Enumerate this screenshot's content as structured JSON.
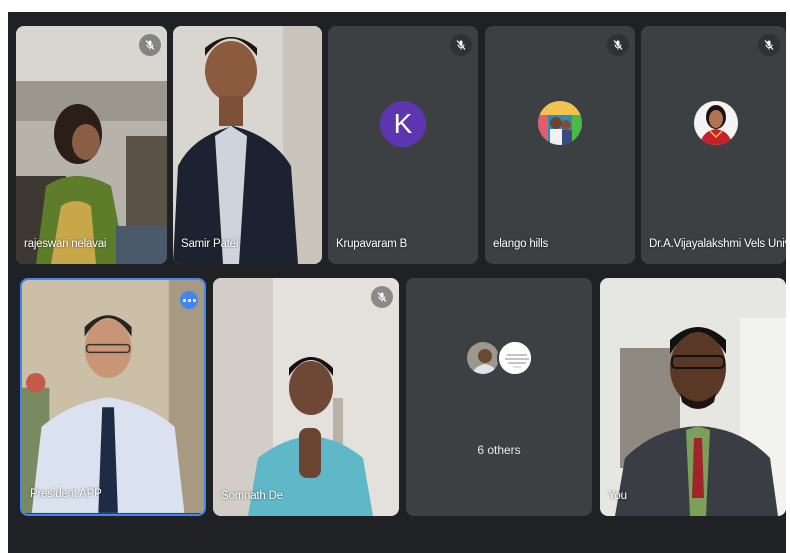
{
  "meeting": {
    "participants": [
      {
        "name": "rajeswari nelavai",
        "muted": true
      },
      {
        "name": "Samir Patel",
        "muted": false
      },
      {
        "name": "Krupavaram B",
        "muted": true,
        "initial": "K",
        "avatar_color": "#5e35b1"
      },
      {
        "name": "elango hills",
        "muted": true
      },
      {
        "name": "Dr.A.Vijayalakshmi Vels University",
        "muted": true
      },
      {
        "name": "President APP",
        "muted": false,
        "active_speaker": true
      },
      {
        "name": "Somnath De",
        "muted": true
      },
      {
        "name": "6 others",
        "muted": false
      },
      {
        "name": "You",
        "muted": false
      }
    ]
  },
  "colors": {
    "background": "#202124",
    "tile": "#3c4043",
    "active_border": "#4285f4",
    "label": "#ffffff"
  },
  "icons": {
    "mute": "mic-off-icon",
    "more": "more-options-icon"
  }
}
